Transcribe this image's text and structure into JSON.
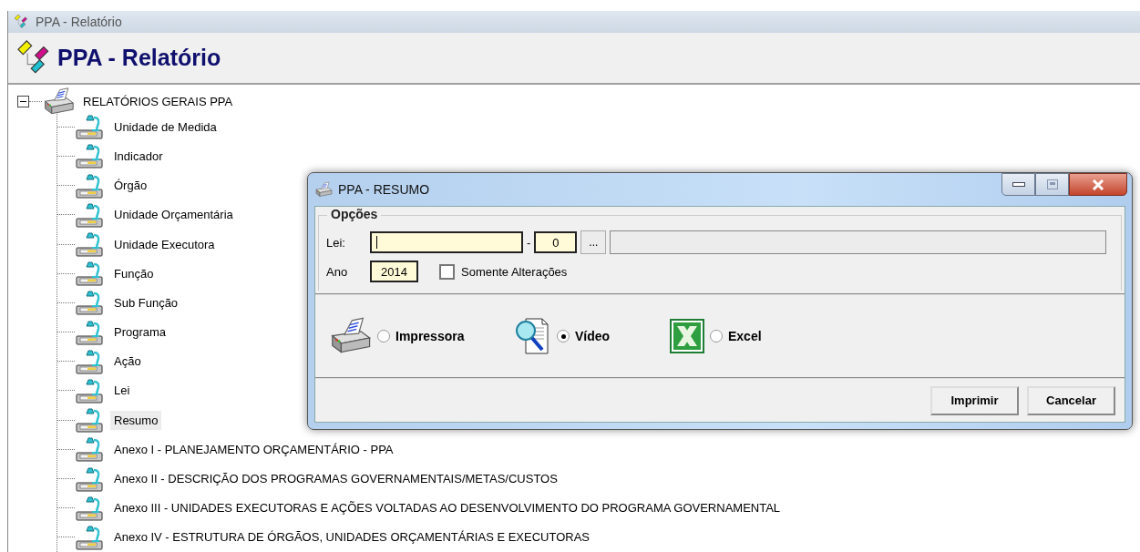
{
  "app": {
    "window_title": "PPA - Relatório",
    "header_title": "PPA - Relatório"
  },
  "tree": {
    "label": "RELATÓRIOS GERAIS PPA",
    "expanded": true,
    "children": [
      {
        "label": "Unidade de Medida",
        "selected": false
      },
      {
        "label": "Indicador",
        "selected": false
      },
      {
        "label": "Órgão",
        "selected": false
      },
      {
        "label": "Unidade Orçamentária",
        "selected": false
      },
      {
        "label": "Unidade Executora",
        "selected": false
      },
      {
        "label": "Função",
        "selected": false
      },
      {
        "label": "Sub Função",
        "selected": false
      },
      {
        "label": "Programa",
        "selected": false
      },
      {
        "label": "Ação",
        "selected": false
      },
      {
        "label": "Lei",
        "selected": false
      },
      {
        "label": "Resumo",
        "selected": true
      },
      {
        "label": "Anexo I - PLANEJAMENTO ORÇAMENTÁRIO - PPA",
        "selected": false
      },
      {
        "label": "Anexo II - DESCRIÇÃO DOS PROGRAMAS GOVERNAMENTAIS/METAS/CUSTOS",
        "selected": false
      },
      {
        "label": "Anexo III - UNIDADES EXECUTORAS E AÇÕES VOLTADAS AO DESENVOLVIMENTO DO PROGRAMA GOVERNAMENTAL",
        "selected": false
      },
      {
        "label": "Anexo IV - ESTRUTURA DE ÓRGÃOS, UNIDADES ORÇAMENTÁRIAS E EXECUTORAS",
        "selected": false
      }
    ]
  },
  "dialog": {
    "title": "PPA - RESUMO",
    "group_title": "Opções",
    "lei": {
      "label": "Lei:",
      "separator": "-",
      "number": "0",
      "browse": "..."
    },
    "ano": {
      "label": "Ano",
      "value": "2014"
    },
    "only_changes": {
      "label": "Somente Alterações",
      "checked": false
    },
    "outputs": [
      {
        "kind": "printer",
        "label": "Impressora",
        "selected": false
      },
      {
        "kind": "preview",
        "label": "Vídeo",
        "selected": true
      },
      {
        "kind": "excel",
        "label": "Excel",
        "selected": false
      }
    ],
    "buttons": [
      "Imprimir",
      "Cancelar"
    ]
  }
}
